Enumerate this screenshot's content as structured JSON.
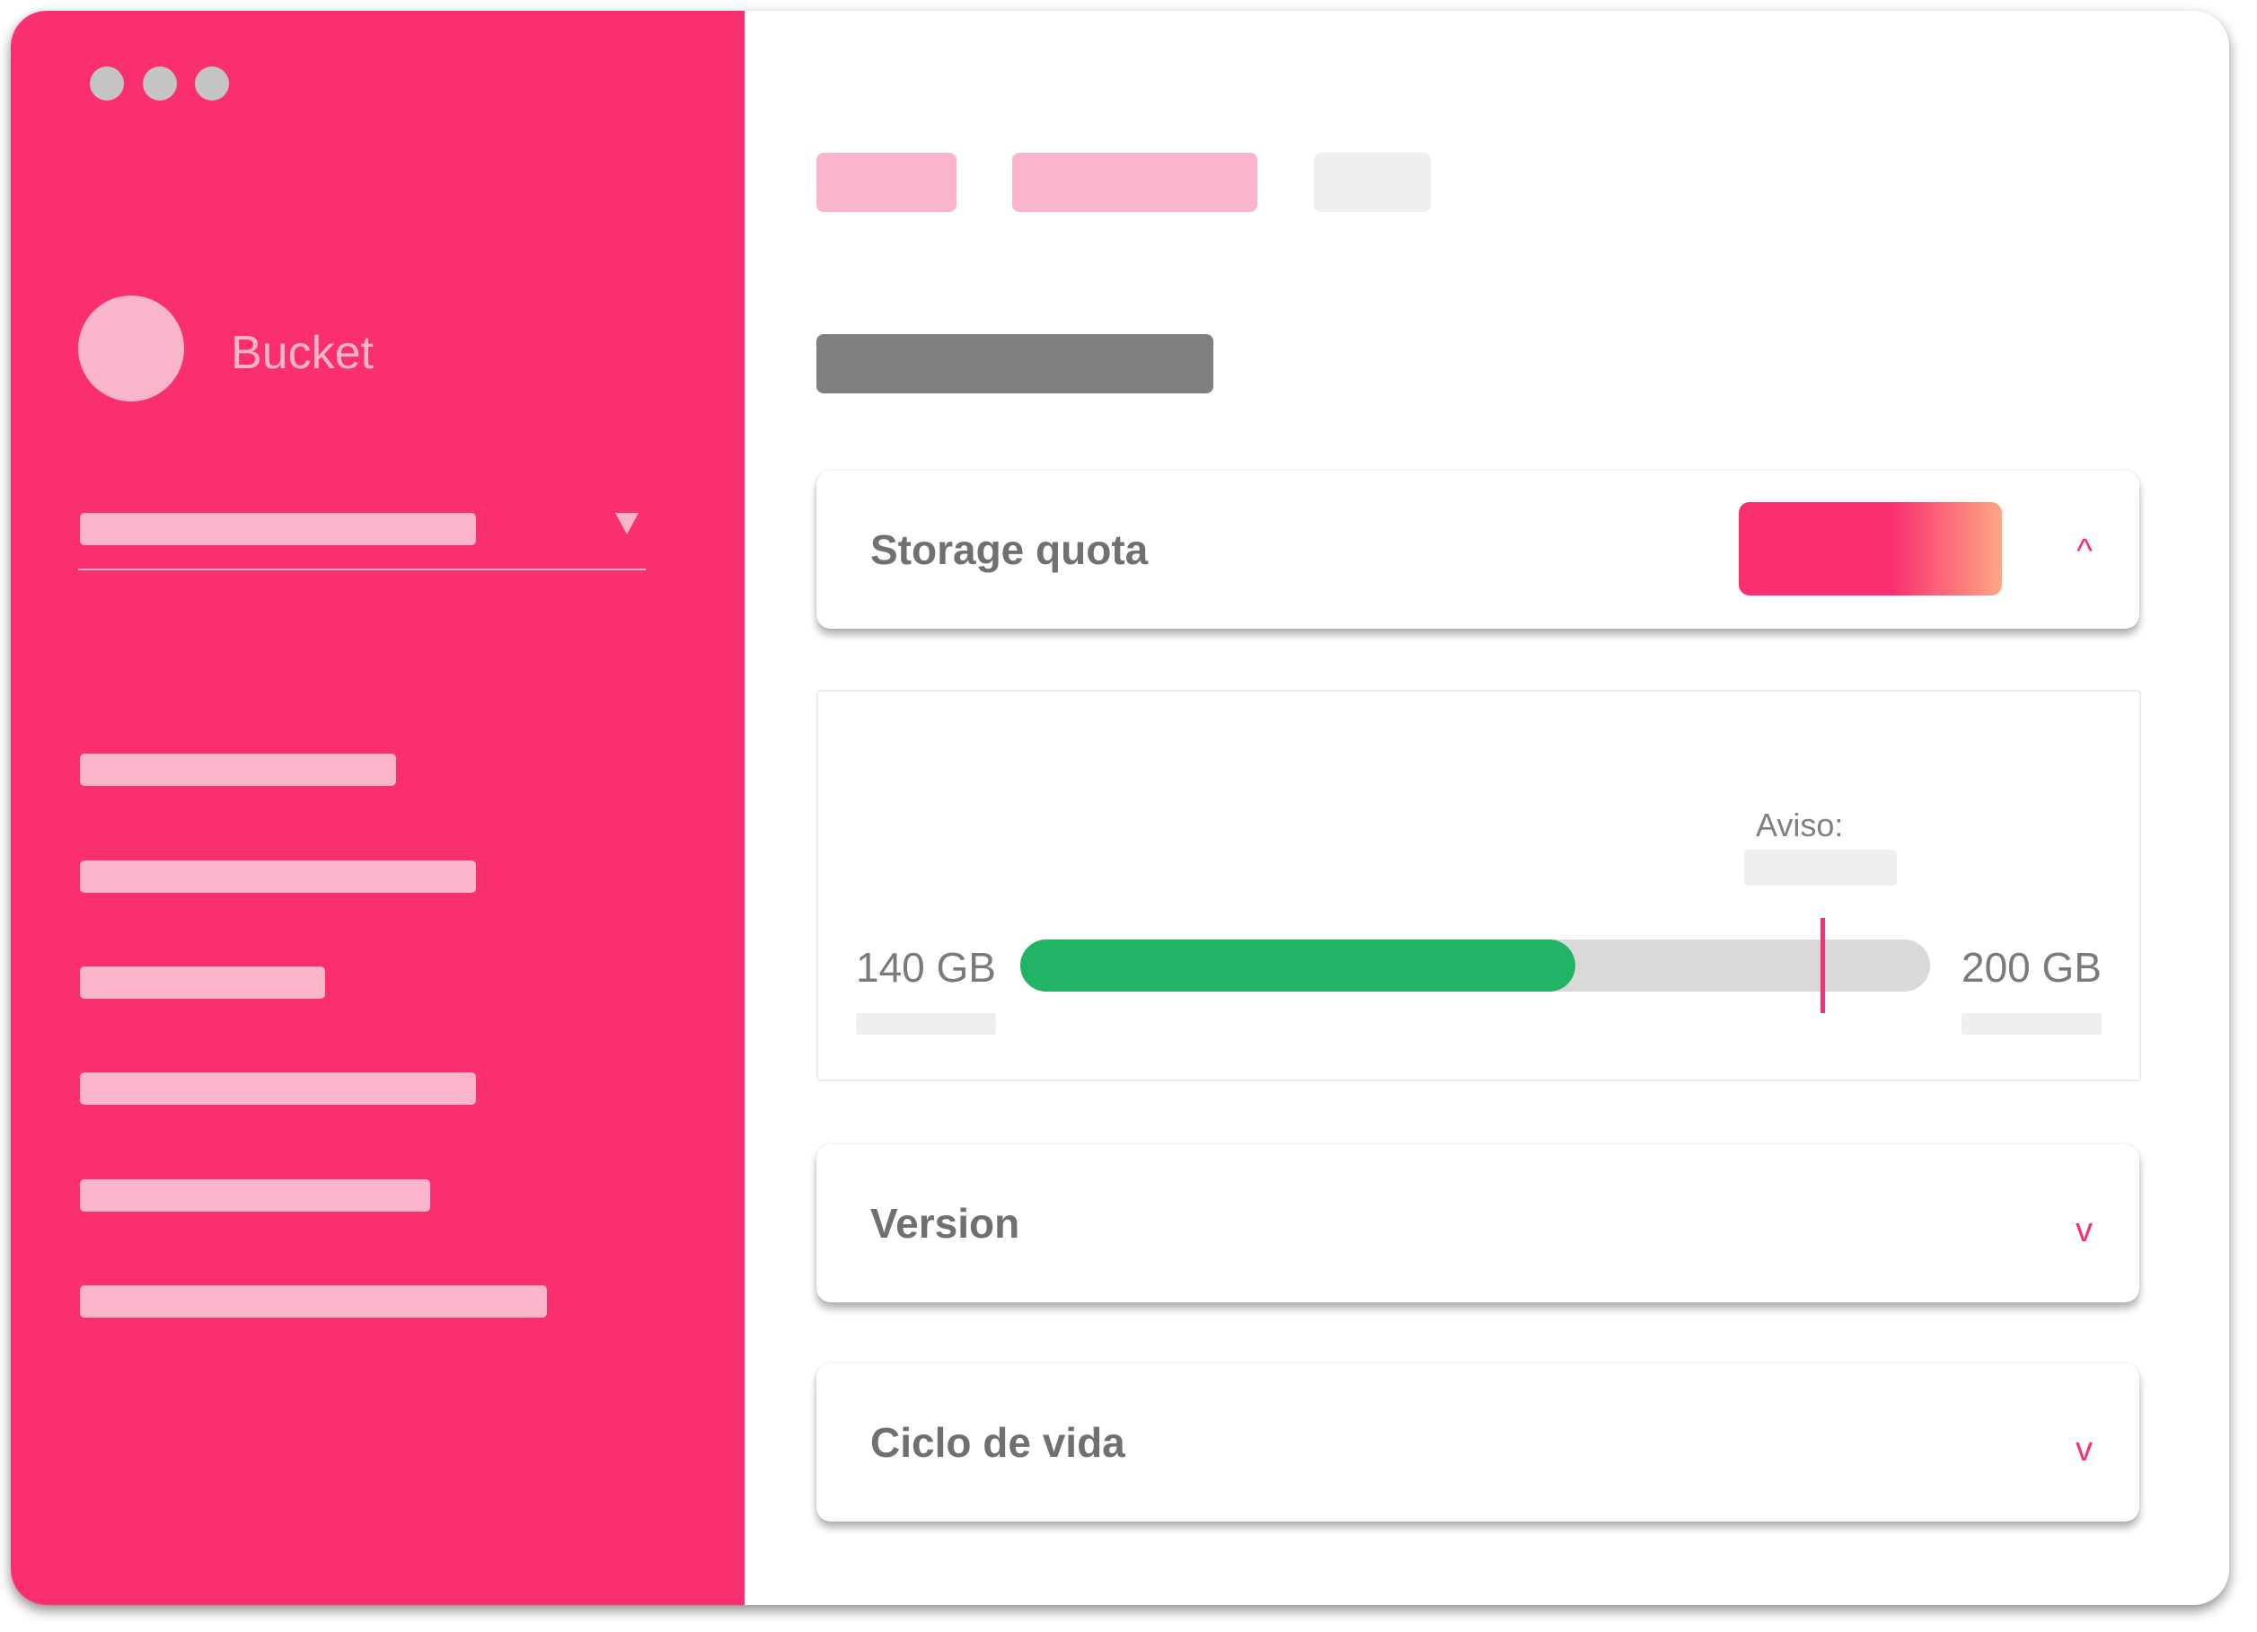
{
  "app": {
    "title": "Bucket"
  },
  "colors": {
    "accent": "#f92f6f",
    "accent_light": "#fbb5ca",
    "usage_fill": "#22b465",
    "track": "#d9d9d9",
    "gradient_end": "#fea784"
  },
  "panels": {
    "storage_quota": {
      "title": "Storage quota",
      "chevron": "^",
      "chevron_icon": "chevron-up-icon"
    },
    "version": {
      "title": "Version",
      "chevron": "v",
      "chevron_icon": "chevron-down-icon"
    },
    "lifecycle": {
      "title": "Ciclo de vida",
      "chevron": "v",
      "chevron_icon": "chevron-down-icon"
    }
  },
  "quota": {
    "warning_label": "Aviso:",
    "min_label": "140 GB",
    "max_label": "200 GB",
    "usage_fraction": 0.61,
    "warning_fraction": 0.88
  }
}
